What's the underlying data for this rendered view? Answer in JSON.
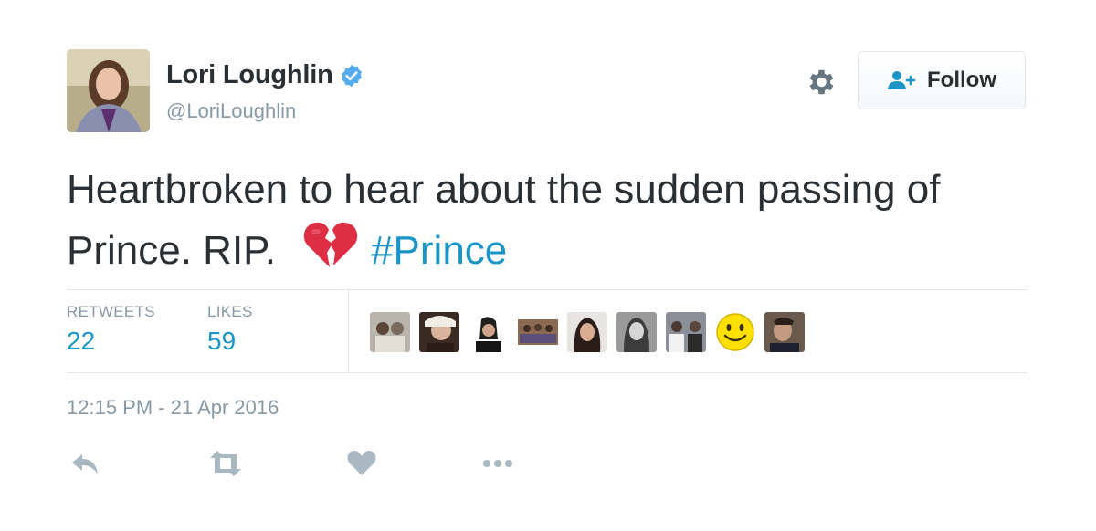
{
  "author": {
    "display_name": "Lori Loughlin",
    "handle": "@LoriLoughlin",
    "verified": true
  },
  "header": {
    "follow_label": "Follow"
  },
  "tweet": {
    "text_main": "Heartbroken to hear about the sudden passing of Prince. RIP.",
    "emoji": "broken-heart",
    "hashtag": "#Prince"
  },
  "stats": {
    "retweets_label": "RETWEETS",
    "retweets_count": "22",
    "likes_label": "LIKES",
    "likes_count": "59",
    "likers_count": 9
  },
  "timestamp": "12:15 PM - 21 Apr 2016",
  "actions": [
    "reply-icon",
    "retweet-icon",
    "like-icon",
    "more-icon"
  ],
  "colors": {
    "text": "#292f33",
    "muted": "#8899a6",
    "link": "#1b95c6",
    "verified": "#55acee",
    "border": "#e1e8ed"
  }
}
